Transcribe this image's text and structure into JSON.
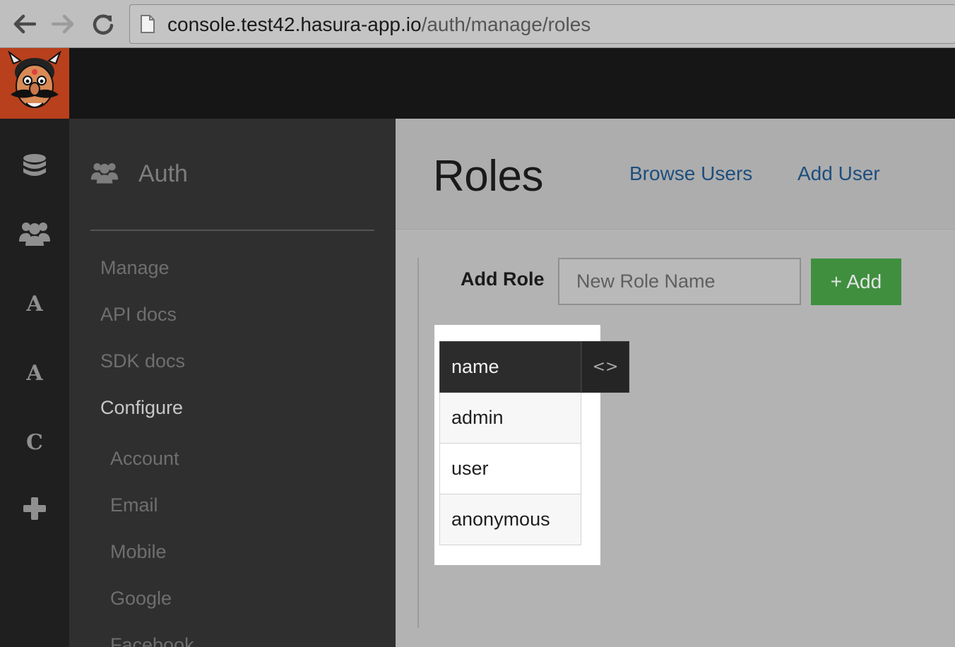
{
  "browser": {
    "url_host": "console.test42.hasura-app.io",
    "url_path": "/auth/manage/roles",
    "icons": [
      "back-arrow-icon",
      "forward-arrow-icon",
      "reload-icon",
      "page-icon"
    ]
  },
  "app": {
    "logo_icon": "hasura-mascot-logo",
    "rail": [
      {
        "icon": "database-icon"
      },
      {
        "icon": "users-icon"
      },
      {
        "label": "A"
      },
      {
        "label": "A"
      },
      {
        "label": "C"
      },
      {
        "icon": "plus-icon"
      }
    ]
  },
  "sidebar": {
    "title": "Auth",
    "title_icon": "users-icon",
    "links": [
      {
        "label": "Manage",
        "active": false
      },
      {
        "label": "API docs",
        "active": false
      },
      {
        "label": "SDK docs",
        "active": false
      },
      {
        "label": "Configure",
        "active": true
      },
      {
        "label": "Account",
        "active": false
      },
      {
        "label": "Email",
        "active": false
      },
      {
        "label": "Mobile",
        "active": false
      },
      {
        "label": "Google",
        "active": false
      },
      {
        "label": "Facebook",
        "active": false
      }
    ]
  },
  "main": {
    "title": "Roles",
    "browse_users_link": "Browse Users",
    "add_user_link": "Add User",
    "add_role_label": "Add Role",
    "role_input_placeholder": "New Role Name",
    "add_button": "+ Add",
    "table": {
      "header": "name",
      "expand_label": "<>",
      "rows": [
        "admin",
        "user",
        "anonymous"
      ]
    }
  },
  "colors": {
    "logo_bg": "#b8401c",
    "add_button_bg": "#3f8f3f",
    "link": "#1d4e7d"
  }
}
